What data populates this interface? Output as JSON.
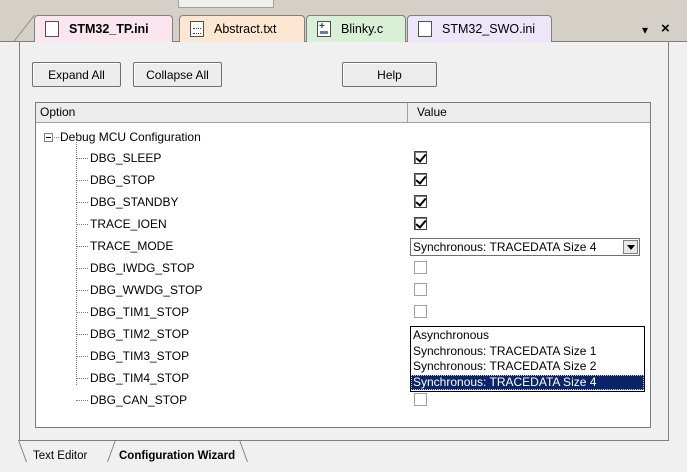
{
  "tabs": [
    {
      "label": "STM32_TP.ini",
      "icon": "ini-file-icon",
      "active": true
    },
    {
      "label": "Abstract.txt",
      "icon": "text-file-icon",
      "active": false
    },
    {
      "label": "Blinky.c",
      "icon": "c-file-icon",
      "active": false
    },
    {
      "label": "STM32_SWO.ini",
      "icon": "ini-file-icon",
      "active": false
    }
  ],
  "tab_controls": {
    "pin": "▾",
    "close": "×"
  },
  "toolbar": {
    "expand_label": "Expand All",
    "collapse_label": "Collapse All",
    "help_label": "Help"
  },
  "grid": {
    "columns": [
      "Option",
      "Value"
    ],
    "root": {
      "label": "Debug MCU Configuration",
      "expanded": true
    },
    "rows": [
      {
        "label": "DBG_SLEEP",
        "type": "checkbox",
        "checked": true
      },
      {
        "label": "DBG_STOP",
        "type": "checkbox",
        "checked": true
      },
      {
        "label": "DBG_STANDBY",
        "type": "checkbox",
        "checked": true
      },
      {
        "label": "TRACE_IOEN",
        "type": "checkbox",
        "checked": true
      },
      {
        "label": "TRACE_MODE",
        "type": "select",
        "value": "Synchronous: TRACEDATA Size 4"
      },
      {
        "label": "DBG_IWDG_STOP",
        "type": "checkbox",
        "checked": false
      },
      {
        "label": "DBG_WWDG_STOP",
        "type": "checkbox",
        "checked": false
      },
      {
        "label": "DBG_TIM1_STOP",
        "type": "checkbox",
        "checked": false
      },
      {
        "label": "DBG_TIM2_STOP",
        "type": "checkbox",
        "checked": false
      },
      {
        "label": "DBG_TIM3_STOP",
        "type": "checkbox",
        "checked": false
      },
      {
        "label": "DBG_TIM4_STOP",
        "type": "checkbox",
        "checked": false
      },
      {
        "label": "DBG_CAN_STOP",
        "type": "checkbox",
        "checked": false
      }
    ]
  },
  "dropdown": {
    "options": [
      "Asynchronous",
      "Synchronous: TRACEDATA Size 1",
      "Synchronous: TRACEDATA Size 2",
      "Synchronous: TRACEDATA Size 4"
    ],
    "selected_index": 3
  },
  "bottom_tabs": [
    {
      "label": "Text Editor",
      "active": false
    },
    {
      "label": "Configuration Wizard",
      "active": true
    }
  ]
}
